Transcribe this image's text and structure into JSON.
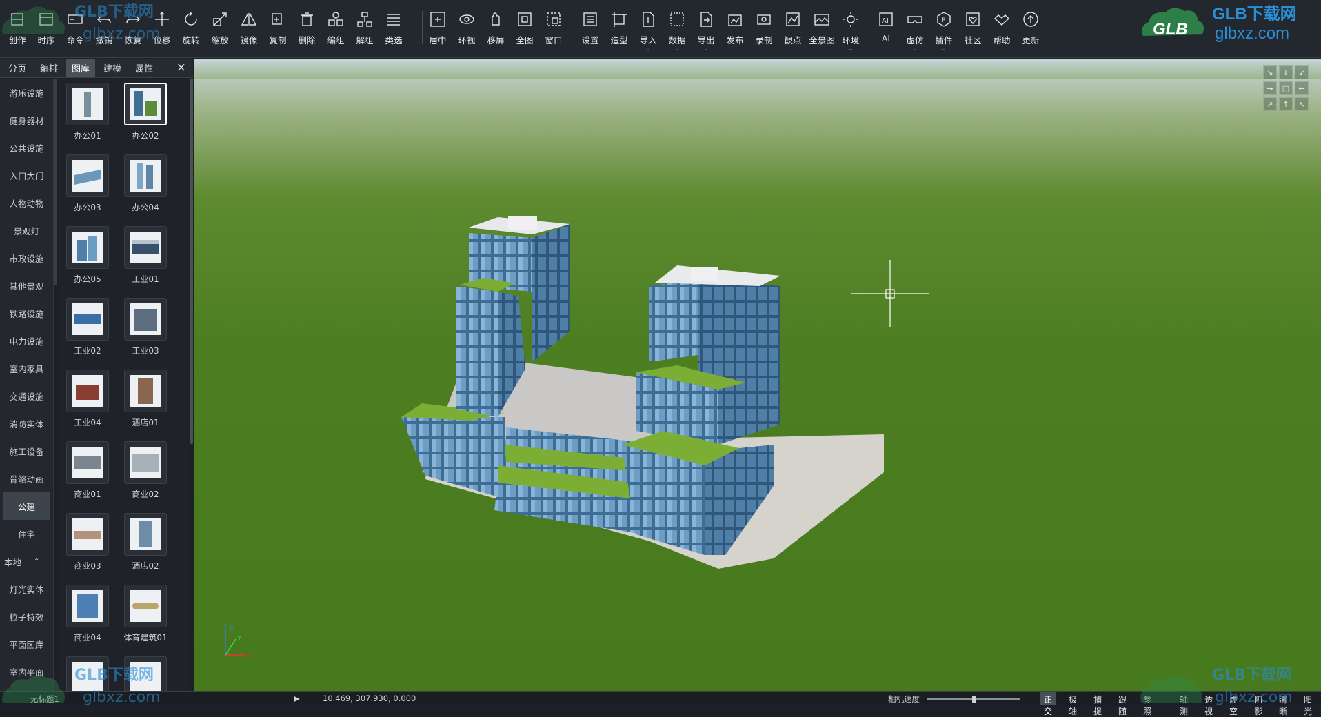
{
  "toolbar": {
    "group1": [
      {
        "label": "创作",
        "icon": "create-icon"
      },
      {
        "label": "时序",
        "icon": "timeline-icon"
      },
      {
        "label": "命令",
        "icon": "command-icon"
      },
      {
        "label": "撤销",
        "icon": "undo-icon"
      },
      {
        "label": "恢复",
        "icon": "redo-icon"
      },
      {
        "label": "位移",
        "icon": "move-icon"
      },
      {
        "label": "旋转",
        "icon": "rotate-icon"
      },
      {
        "label": "缩放",
        "icon": "scale-icon"
      },
      {
        "label": "镜像",
        "icon": "mirror-icon"
      },
      {
        "label": "复制",
        "icon": "copy-icon"
      },
      {
        "label": "删除",
        "icon": "delete-icon"
      },
      {
        "label": "编组",
        "icon": "group-icon"
      },
      {
        "label": "解组",
        "icon": "ungroup-icon"
      },
      {
        "label": "类选",
        "icon": "select-similar-icon"
      }
    ],
    "group2": [
      {
        "label": "居中",
        "icon": "center-icon"
      },
      {
        "label": "环视",
        "icon": "orbit-icon"
      },
      {
        "label": "移屏",
        "icon": "pan-hand-icon"
      },
      {
        "label": "全图",
        "icon": "zoom-extents-icon"
      },
      {
        "label": "窗口",
        "icon": "zoom-window-icon"
      }
    ],
    "group3": [
      {
        "label": "设置",
        "icon": "settings-icon"
      },
      {
        "label": "造型",
        "icon": "modeling-icon"
      },
      {
        "label": "导入",
        "icon": "import-icon",
        "caret": true
      },
      {
        "label": "数据",
        "icon": "data-icon",
        "caret": true
      },
      {
        "label": "导出",
        "icon": "export-icon",
        "caret": true
      },
      {
        "label": "发布",
        "icon": "publish-icon"
      },
      {
        "label": "录制",
        "icon": "record-icon"
      },
      {
        "label": "観点",
        "icon": "viewpoint-icon"
      },
      {
        "label": "全景图",
        "icon": "panorama-icon"
      },
      {
        "label": "环境",
        "icon": "environment-sun-icon",
        "caret": true
      }
    ],
    "group4": [
      {
        "label": "AI",
        "icon": "ai-icon"
      },
      {
        "label": "虚仿",
        "icon": "vr-icon",
        "caret": true
      },
      {
        "label": "插件",
        "icon": "plugin-icon",
        "caret": true
      },
      {
        "label": "社区",
        "icon": "community-icon"
      },
      {
        "label": "帮助",
        "icon": "help-handshake-icon"
      },
      {
        "label": "更新",
        "icon": "update-icon"
      }
    ]
  },
  "panel": {
    "tabs": [
      "分页",
      "编排",
      "图库",
      "建模",
      "属性"
    ],
    "active_tab": "图库",
    "close": "×",
    "categories": [
      "游乐设施",
      "健身器材",
      "公共设施",
      "入口大门",
      "人物动物",
      "景观灯",
      "市政设施",
      "其他景观",
      "铁路设施",
      "电力设施",
      "室内家具",
      "交通设施",
      "消防实体",
      "施工设备",
      "骨骼动画",
      "公建",
      "住宅",
      "本地",
      "灯光实体",
      "粒子特效",
      "平面图库",
      "室内平面"
    ],
    "active_category": "公建",
    "local_chevron": "⌃",
    "items": [
      {
        "label": "办公01",
        "selected": false
      },
      {
        "label": "办公02",
        "selected": true
      },
      {
        "label": "办公03",
        "selected": false
      },
      {
        "label": "办公04",
        "selected": false
      },
      {
        "label": "办公05",
        "selected": false
      },
      {
        "label": "工业01",
        "selected": false
      },
      {
        "label": "工业02",
        "selected": false
      },
      {
        "label": "工业03",
        "selected": false
      },
      {
        "label": "工业04",
        "selected": false
      },
      {
        "label": "酒店01",
        "selected": false
      },
      {
        "label": "商业01",
        "selected": false
      },
      {
        "label": "商业02",
        "selected": false
      },
      {
        "label": "商业03",
        "selected": false
      },
      {
        "label": "酒店02",
        "selected": false
      },
      {
        "label": "商业04",
        "selected": false
      },
      {
        "label": "体育建筑01",
        "selected": false
      }
    ]
  },
  "viewport": {
    "axis": {
      "x": "X",
      "y": "Y",
      "z": "Z"
    },
    "nav_cube": [
      "↘",
      "↓",
      "↙",
      "→",
      "□",
      "←",
      "↗",
      "↑",
      "↖"
    ]
  },
  "status": {
    "doc_name": "无标题1",
    "play": "▶",
    "coords": "10.469, 307.930, 0.000",
    "camera_speed_label": "相机速度",
    "camera_speed": 0.5,
    "toggles": [
      {
        "label": "正交",
        "on": true
      },
      {
        "label": "极轴",
        "on": false
      },
      {
        "label": "捕捉",
        "on": false
      },
      {
        "label": "跟随",
        "on": false
      },
      {
        "label": "参照",
        "on": false
      },
      {
        "label": "轴测",
        "on": false
      },
      {
        "label": "透视",
        "on": false
      },
      {
        "label": "虚空",
        "on": false
      },
      {
        "label": "阴影",
        "on": false
      },
      {
        "label": "清晰",
        "on": false
      },
      {
        "label": "阳光",
        "on": false
      }
    ]
  },
  "watermark": {
    "brand": "GLB下载网",
    "logo_text": "GLB",
    "url": "glbxz.com"
  },
  "colors": {
    "ground": "#4d7e22",
    "sky": "#c9d7dc",
    "glass": "#4f7fa6",
    "roof_green": "#7cad35"
  }
}
